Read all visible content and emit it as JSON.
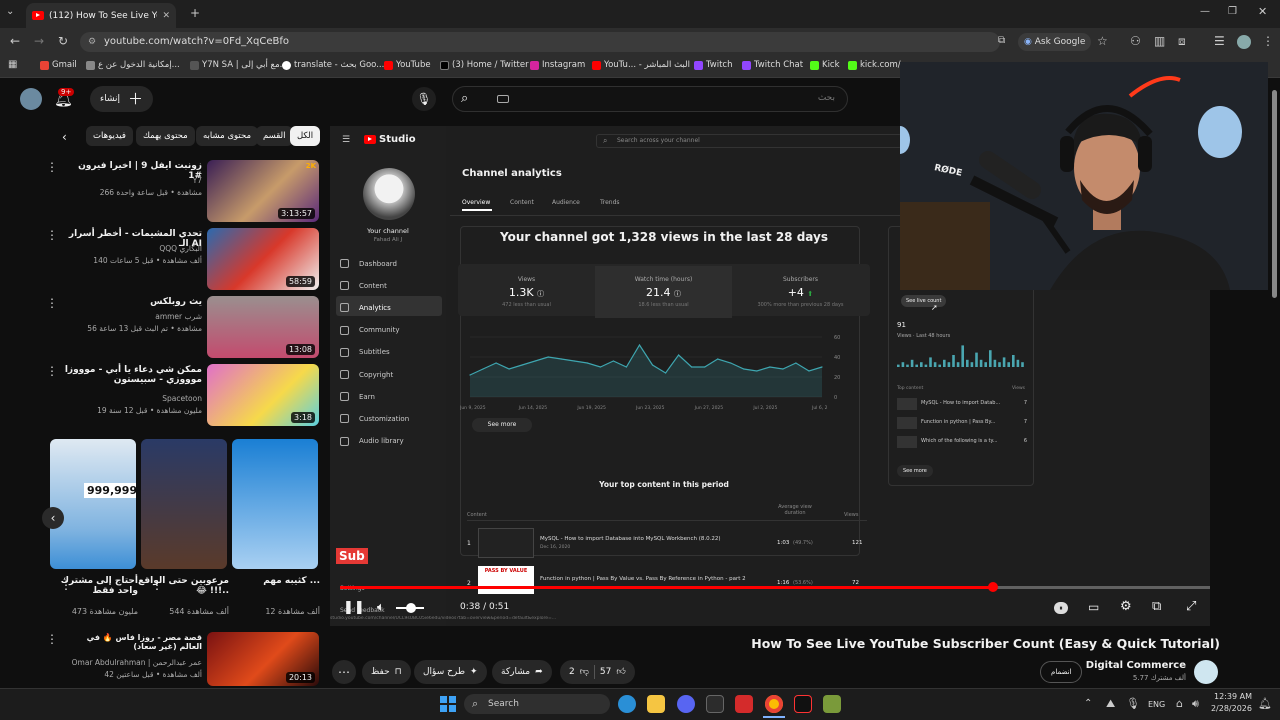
{
  "browser": {
    "tab_title": "(112) How To See Live YouT",
    "url": "youtube.com/watch?v=0Fd_XqCeBfo",
    "ask_google": "Ask Google",
    "bookmarks": [
      "Gmail",
      "إمكانية الدخول عن ع...",
      "Y7N SA | مع أبي إلى...",
      "translate - بحث Goo...",
      "YouTube",
      "(3) Home / Twitter",
      "Instagram",
      "YouTu... - البث المباشر",
      "Twitch",
      "Twitch Chat",
      "Kick",
      "kick.com/p"
    ]
  },
  "youtube": {
    "search_placeholder": "بحث",
    "create_label": "إنشاء",
    "notif_count": "9+",
    "chips": [
      "الكل",
      "القسم",
      "محتوى مشابه",
      "محتوى يهمك",
      "فيديوهات"
    ],
    "recs": [
      {
        "title": "زونبت ايفل 9 | اخيرا فيرون #1",
        "channel": "Y7",
        "meta": "266 مشاهدة • قبل ساعة واحدة",
        "duration": "3:13:57",
        "badge": "2K"
      },
      {
        "title": "تحدي المشيمات - أخطر أسرار الـ AI",
        "channel": "QQQ البكاري",
        "meta": "140 ألف مشاهدة • قبل 5 ساعات",
        "duration": "58:59",
        "badge": ""
      },
      {
        "title": "يث روبلكس",
        "channel": "ammer شرب",
        "meta": "56 مشاهدة • تم البث قبل 13 ساعة",
        "duration": "13:08",
        "badge": ""
      },
      {
        "title": "ممكن شي دعاء يا أبي - موووزا موووزي - سبيستون",
        "channel": "Spacetoon",
        "meta": "19 مليون مشاهدة • قبل 12 سنة",
        "duration": "3:18",
        "badge": ""
      }
    ],
    "shorts": [
      {
        "title": "أحتاج إلى مشترك واحد فقط",
        "meta": "473 مليون مشاهدة"
      },
      {
        "title": "مرعوبين حتى الواقع 😂 !!!..",
        "meta": "544 ألف مشاهدة"
      },
      {
        "title": "كثيبه مهم ...",
        "meta": "12 ألف مشاهدة"
      }
    ],
    "last_rec": {
      "title": "قصة مصر - روزا فاس 🔥 في العالم (غير سعاد)",
      "channel": "Omar Abdulrahman | عمر عبدالرحمن",
      "meta": "42 ألف مشاهدة • قبل ساعتين",
      "duration": "20:13"
    },
    "video_title": "How To See Live YouTube Subscriber Count (Easy & Quick Tutorial)",
    "channel_name": "Digital Commerce",
    "subs": "5.77 ألف مشترك",
    "join": "انضمام",
    "likes": "57",
    "dislikes": "2",
    "share": "مشاركة",
    "ask": "طرح سؤال",
    "save": "حفظ",
    "time": "0:38 / 0:51",
    "progress": 0.75,
    "sub_overlay": "Sub"
  },
  "studio": {
    "logo": "Studio",
    "search": "Search across your channel",
    "your_channel": "Your channel",
    "channel_sub": "Fahad Ali J",
    "nav": [
      "Dashboard",
      "Content",
      "Analytics",
      "Community",
      "Subtitles",
      "Copyright",
      "Earn",
      "Customization",
      "Audio library"
    ],
    "page_title": "Channel analytics",
    "tabs": [
      "Overview",
      "Content",
      "Audience",
      "Trends"
    ],
    "headline": "Your channel got 1,328 views in the last 28 days",
    "kpis": [
      {
        "label": "Views",
        "value": "1.3K",
        "sub": "472 less than usual"
      },
      {
        "label": "Watch time (hours)",
        "value": "21.4",
        "sub": "18.6 less than usual"
      },
      {
        "label": "Subscribers",
        "value": "+4",
        "sub": "300% more than previous 28 days"
      }
    ],
    "xticks": [
      "Jun 9, 2025",
      "Jun 14, 2025",
      "Jun 19, 2025",
      "Jun 23, 2025",
      "Jun 27, 2025",
      "Jul 2, 2025",
      "Jul 6, 2"
    ],
    "yticks": [
      "60",
      "40",
      "20",
      "0"
    ],
    "see_more": "See more",
    "top_content": "Your top content in this period",
    "table_headers": [
      "Content",
      "Average view duration",
      "Views"
    ],
    "rows": [
      {
        "n": "1",
        "title": "MySQL - How to import Database into MySQL Workbench (8.0.22)",
        "date": "Dec 16, 2020",
        "dur": "1:03",
        "pct": "(49.7%)",
        "views": "121"
      },
      {
        "n": "2",
        "title": "Function in python | Pass By Value vs. Pass By Reference in Python - part 2",
        "date": "",
        "dur": "1:16",
        "pct": "(53.6%)",
        "views": "72"
      }
    ],
    "pass_by_value": "PASS BY VALUE",
    "realtime_btn": "See live count",
    "realtime_value": "91",
    "realtime_label": "Views · Last 48 hours",
    "top_content_label": "Top content",
    "views_label": "Views",
    "rt_items": [
      {
        "title": "MySQL - How to import Datab...",
        "v": "7"
      },
      {
        "title": "Function in python | Pass By...",
        "v": "7"
      },
      {
        "title": "Which of the following is a ty...",
        "v": "6"
      }
    ],
    "settings": "Settings",
    "send": "Send feedback",
    "status_url": "studio.youtube.com/channel/UCL9sUBC05ie6edu/videos?tab=overview&period=default&explore=..."
  },
  "webcam": {
    "mic_brand": "RØDE"
  },
  "taskbar": {
    "search": "Search",
    "lang": "ENG",
    "time": "12:39 AM",
    "date": "2/28/2026"
  },
  "chart_data": {
    "type": "line",
    "title": "Views",
    "values": [
      22,
      28,
      34,
      28,
      32,
      36,
      40,
      38,
      36,
      34,
      30,
      36,
      30,
      52,
      32,
      24,
      42,
      30,
      30,
      38,
      34,
      28,
      26,
      30,
      28,
      34,
      26,
      30
    ],
    "ylim": [
      0,
      60
    ]
  }
}
